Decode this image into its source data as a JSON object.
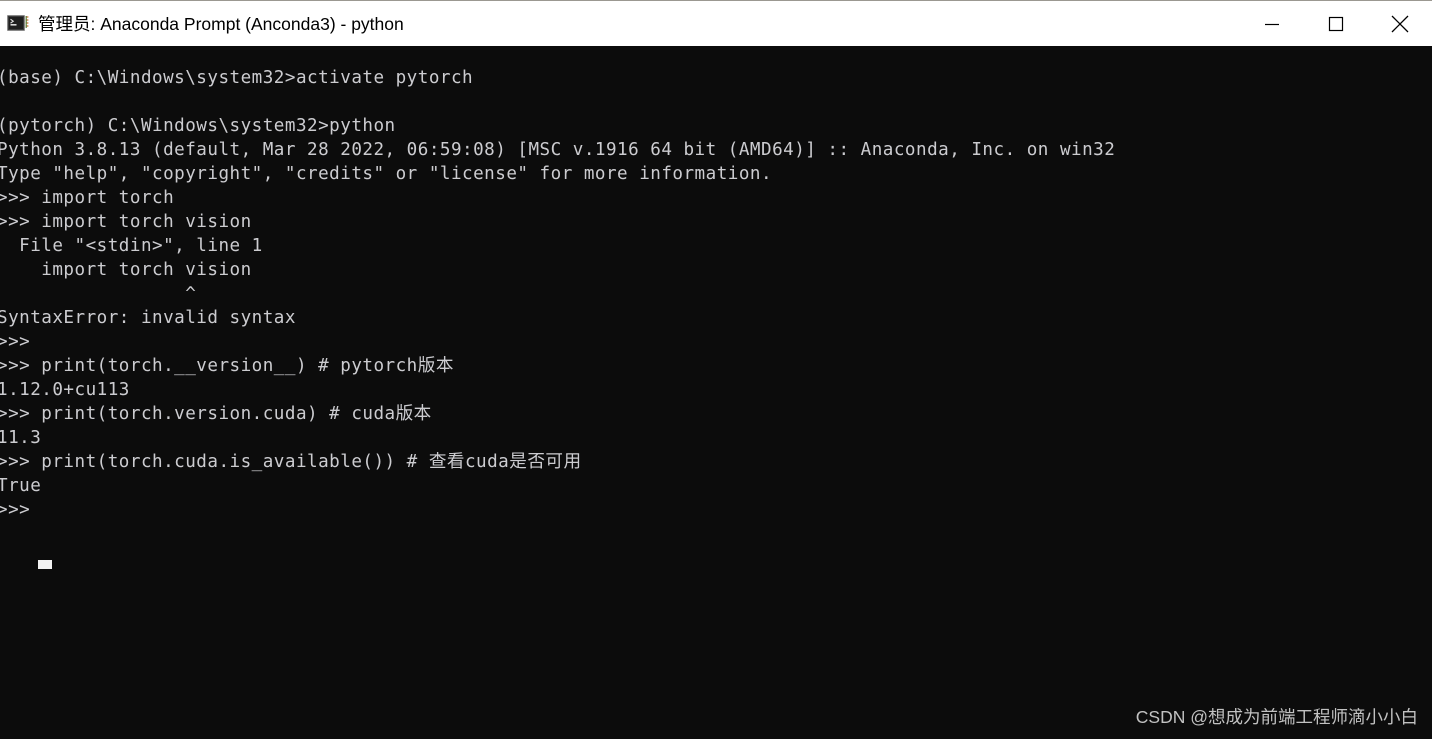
{
  "window": {
    "title": "管理员: Anaconda Prompt (Anconda3) - python",
    "icon": "console-icon",
    "background_color": "#0c0c0c",
    "titlebar_color": "#ffffff",
    "text_color": "#ccccd0",
    "controls": {
      "minimize_label": "—",
      "maximize_label": "▢",
      "close_label": "✕"
    }
  },
  "terminal": {
    "lines": [
      "(base) C:\\Windows\\system32>activate pytorch",
      "",
      "(pytorch) C:\\Windows\\system32>python",
      "Python 3.8.13 (default, Mar 28 2022, 06:59:08) [MSC v.1916 64 bit (AMD64)] :: Anaconda, Inc. on win32",
      "Type \"help\", \"copyright\", \"credits\" or \"license\" for more information.",
      ">>> import torch",
      ">>> import torch vision",
      "  File \"<stdin>\", line 1",
      "    import torch vision",
      "                 ^",
      "SyntaxError: invalid syntax",
      ">>>",
      ">>> print(torch.__version__) # pytorch版本",
      "1.12.0+cu113",
      ">>> print(torch.version.cuda) # cuda版本",
      "11.3",
      ">>> print(torch.cuda.is_available()) # 查看cuda是否可用",
      "True",
      ">>> "
    ],
    "prompt_symbol": ">>>",
    "cursor_visible": true
  },
  "watermark": {
    "text": "CSDN @想成为前端工程师滴小小白"
  }
}
